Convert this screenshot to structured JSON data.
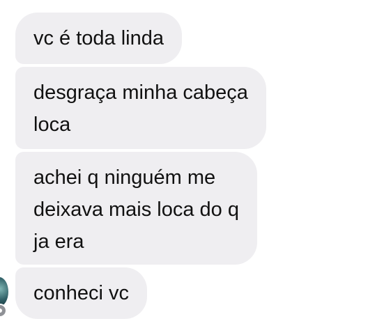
{
  "conversation": {
    "messages": [
      {
        "lines": [
          "vc é toda linda"
        ]
      },
      {
        "lines": [
          "desgraça minha cabeça",
          "loca"
        ]
      },
      {
        "lines": [
          "achei q ninguém me",
          "deixava mais loca do q",
          "ja era"
        ]
      },
      {
        "lines": [
          "conheci vc"
        ]
      }
    ]
  },
  "colors": {
    "bubble_background": "#efeef1",
    "text": "#111111",
    "page_background": "#ffffff"
  },
  "icons": {
    "avatar": "contact-avatar",
    "status": "status-indicator-icon"
  }
}
